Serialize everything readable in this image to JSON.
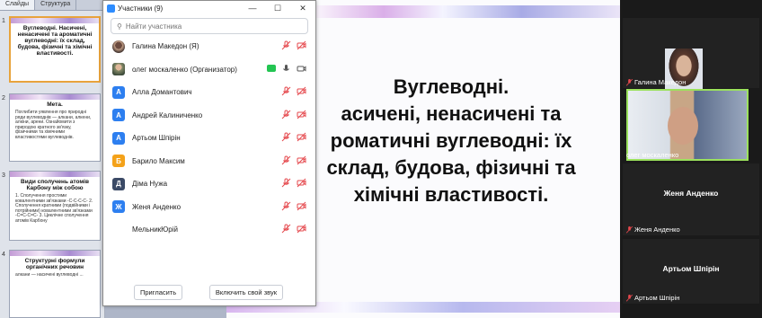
{
  "slides_panel": {
    "tabs": [
      "Слайды",
      "Структура"
    ],
    "thumbs": [
      {
        "num": "1",
        "title": "Вуглеводні. Насичені, ненасичені та ароматичні вуглеводні: їх склад, будова, фізичні та хімічні властивості.",
        "body": ""
      },
      {
        "num": "2",
        "title": "Мета.",
        "body": "Поглибити уявлення про природні ряди вуглеводнів — алкани, алкени, алкіни, арени. Ознайомити з природою кратного зв'язку, фізичними та хімічними властивостями вуглеводнів."
      },
      {
        "num": "3",
        "title": "Види сполучень атомів Карбону між собою",
        "body": "1. Сполучення простими ковалентними зв'язками -C-C-C-C- 2. Сполучення кратними (подвійними і потрійними) ковалентними зв'язками -C=C-C=C- 3. Циклічне сполучення атомів Карбону"
      },
      {
        "num": "4",
        "title": "Структурні формули органічних речовин",
        "body": "алкани — насичені вуглеводні ..."
      }
    ]
  },
  "slide": {
    "lines": [
      "Вуглеводні.",
      "асичені, ненасичені та",
      "роматичні вуглеводні: їх",
      "склад, будова, фізичні та",
      "хімічні властивості."
    ]
  },
  "participants_window": {
    "title": "Участники (9)",
    "search_placeholder": "Найти участника",
    "participants": [
      {
        "name": "Галина Македон (Я)",
        "avatar": "",
        "avatar_color": "",
        "photo": "woman",
        "host": false
      },
      {
        "name": "олег москаленко (Организатор)",
        "avatar": "",
        "avatar_color": "",
        "photo": "man",
        "host": true
      },
      {
        "name": "Алла Домантович",
        "avatar": "А",
        "avatar_color": "#2d7ff0",
        "photo": "",
        "host": false
      },
      {
        "name": "Андрей Калиниченко",
        "avatar": "А",
        "avatar_color": "#2d7ff0",
        "photo": "",
        "host": false
      },
      {
        "name": "Артьом Шпірін",
        "avatar": "А",
        "avatar_color": "#2d7ff0",
        "photo": "",
        "host": false
      },
      {
        "name": "Барило Максим",
        "avatar": "Б",
        "avatar_color": "#f4a21a",
        "photo": "",
        "host": false
      },
      {
        "name": "Діма Нужа",
        "avatar": "Д",
        "avatar_color": "#3b4a66",
        "photo": "",
        "host": false
      },
      {
        "name": "Женя Анденко",
        "avatar": "Ж",
        "avatar_color": "#2d7ff0",
        "photo": "",
        "host": false
      },
      {
        "name": "МельникЮрій",
        "avatar": "",
        "avatar_color": "",
        "photo": "",
        "host": false
      }
    ],
    "invite_label": "Пригласить",
    "unmute_label": "Включить свой звук"
  },
  "gallery": {
    "tiles": [
      {
        "name": "Галина Македон",
        "center": "",
        "kind": "photo-woman"
      },
      {
        "name": "олег москаленко",
        "center": "",
        "kind": "photo-man"
      },
      {
        "name": "Женя Анденко",
        "center": "Женя Анденко",
        "kind": "name"
      },
      {
        "name": "Артьом Шпірін",
        "center": "Артьом Шпірін",
        "kind": "name"
      }
    ]
  },
  "colors": {
    "accent": "#2d8cff",
    "muted_red": "#e5484d",
    "speaker_green": "#9be15d"
  }
}
